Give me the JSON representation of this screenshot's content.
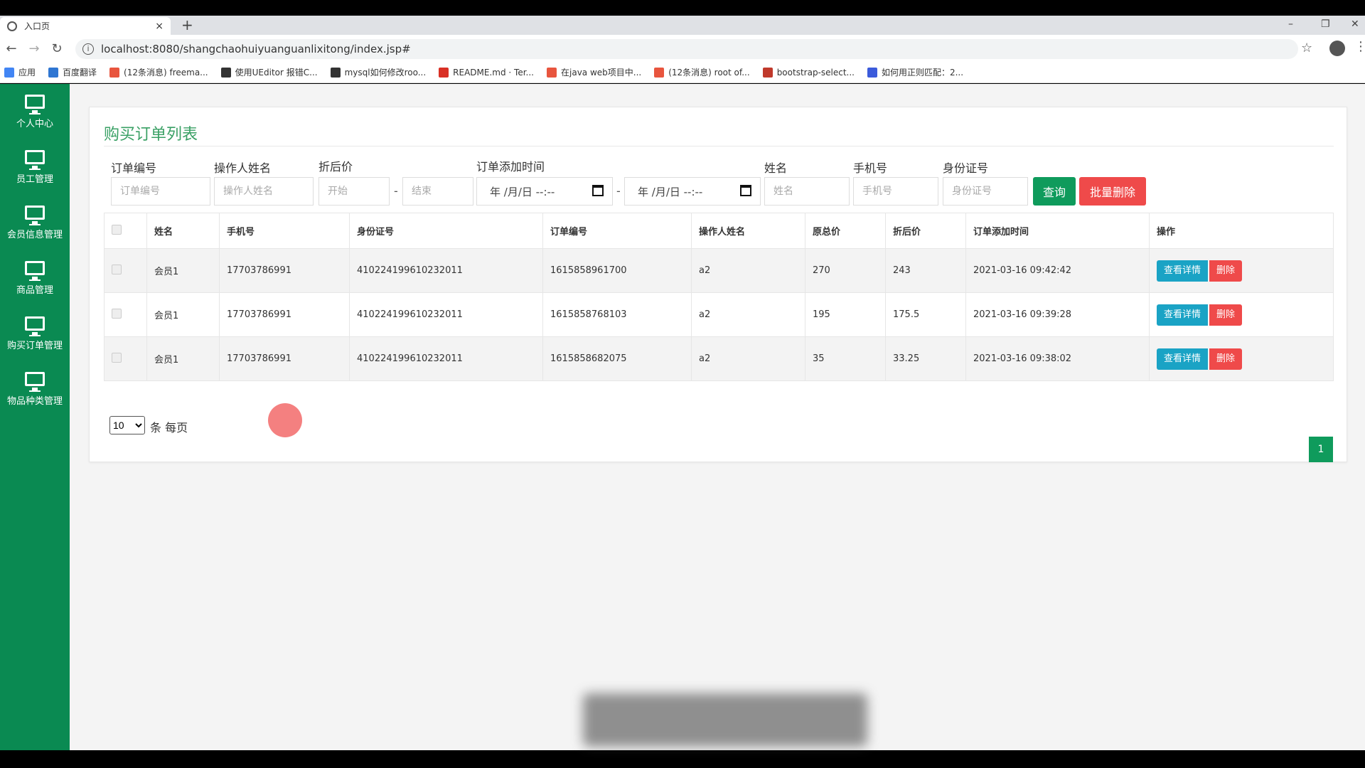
{
  "browser": {
    "tab_title": "入口页",
    "tab_close": "×",
    "new_tab": "+",
    "url": "localhost:8080/shangchaohuiyuanguanlixitong/index.jsp#",
    "win_min": "–",
    "win_max": "❐",
    "win_close": "✕",
    "bookmarks": [
      {
        "label": "应用",
        "color": "#4285f4"
      },
      {
        "label": "百度翻译",
        "color": "#2f76d2"
      },
      {
        "label": "(12条消息) freema...",
        "color": "#e8553e"
      },
      {
        "label": "使用UEditor 报错C...",
        "color": "#333333"
      },
      {
        "label": "mysql如何修改roo...",
        "color": "#333333"
      },
      {
        "label": "README.md · Ter...",
        "color": "#d93025"
      },
      {
        "label": "在java web项目中...",
        "color": "#e8553e"
      },
      {
        "label": "(12条消息) root of...",
        "color": "#e8553e"
      },
      {
        "label": "bootstrap-select...",
        "color": "#c0392b"
      },
      {
        "label": "如何用正则匹配：2...",
        "color": "#3b5bdb"
      }
    ]
  },
  "sidebar": {
    "items": [
      {
        "label": "个人中心"
      },
      {
        "label": "员工管理"
      },
      {
        "label": "会员信息管理"
      },
      {
        "label": "商品管理"
      },
      {
        "label": "购买订单管理"
      },
      {
        "label": "物品种类管理"
      }
    ]
  },
  "page": {
    "title": "购买订单列表"
  },
  "filters": {
    "order_no_label": "订单编号",
    "order_no_placeholder": "订单编号",
    "operator_label": "操作人姓名",
    "operator_placeholder": "操作人姓名",
    "discount_label": "折后价",
    "discount_start_placeholder": "开始",
    "discount_end_placeholder": "结束",
    "time_label": "订单添加时间",
    "time_start_value": "年 /月/日 --:--",
    "time_end_value": "年 /月/日 --:--",
    "name_label": "姓名",
    "name_placeholder": "姓名",
    "phone_label": "手机号",
    "phone_placeholder": "手机号",
    "idcard_label": "身份证号",
    "idcard_placeholder": "身份证号",
    "query_button": "查询",
    "batch_delete_button": "批量删除",
    "dash": "-"
  },
  "table": {
    "headers": [
      "姓名",
      "手机号",
      "身份证号",
      "订单编号",
      "操作人姓名",
      "原总价",
      "折后价",
      "订单添加时间",
      "操作"
    ],
    "detail_label": "查看详情",
    "delete_label": "删除",
    "rows": [
      {
        "name": "会员1",
        "phone": "17703786991",
        "idcard": "410224199610232011",
        "order_no": "1615858961700",
        "operator": "a2",
        "total": "270",
        "discount": "243",
        "time": "2021-03-16 09:42:42"
      },
      {
        "name": "会员1",
        "phone": "17703786991",
        "idcard": "410224199610232011",
        "order_no": "1615858768103",
        "operator": "a2",
        "total": "195",
        "discount": "175.5",
        "time": "2021-03-16 09:39:28"
      },
      {
        "name": "会员1",
        "phone": "17703786991",
        "idcard": "410224199610232011",
        "order_no": "1615858682075",
        "operator": "a2",
        "total": "35",
        "discount": "33.25",
        "time": "2021-03-16 09:38:02"
      }
    ]
  },
  "pager": {
    "page_size": "10",
    "page_size_suffix": "条 每页",
    "current_page": "1"
  }
}
